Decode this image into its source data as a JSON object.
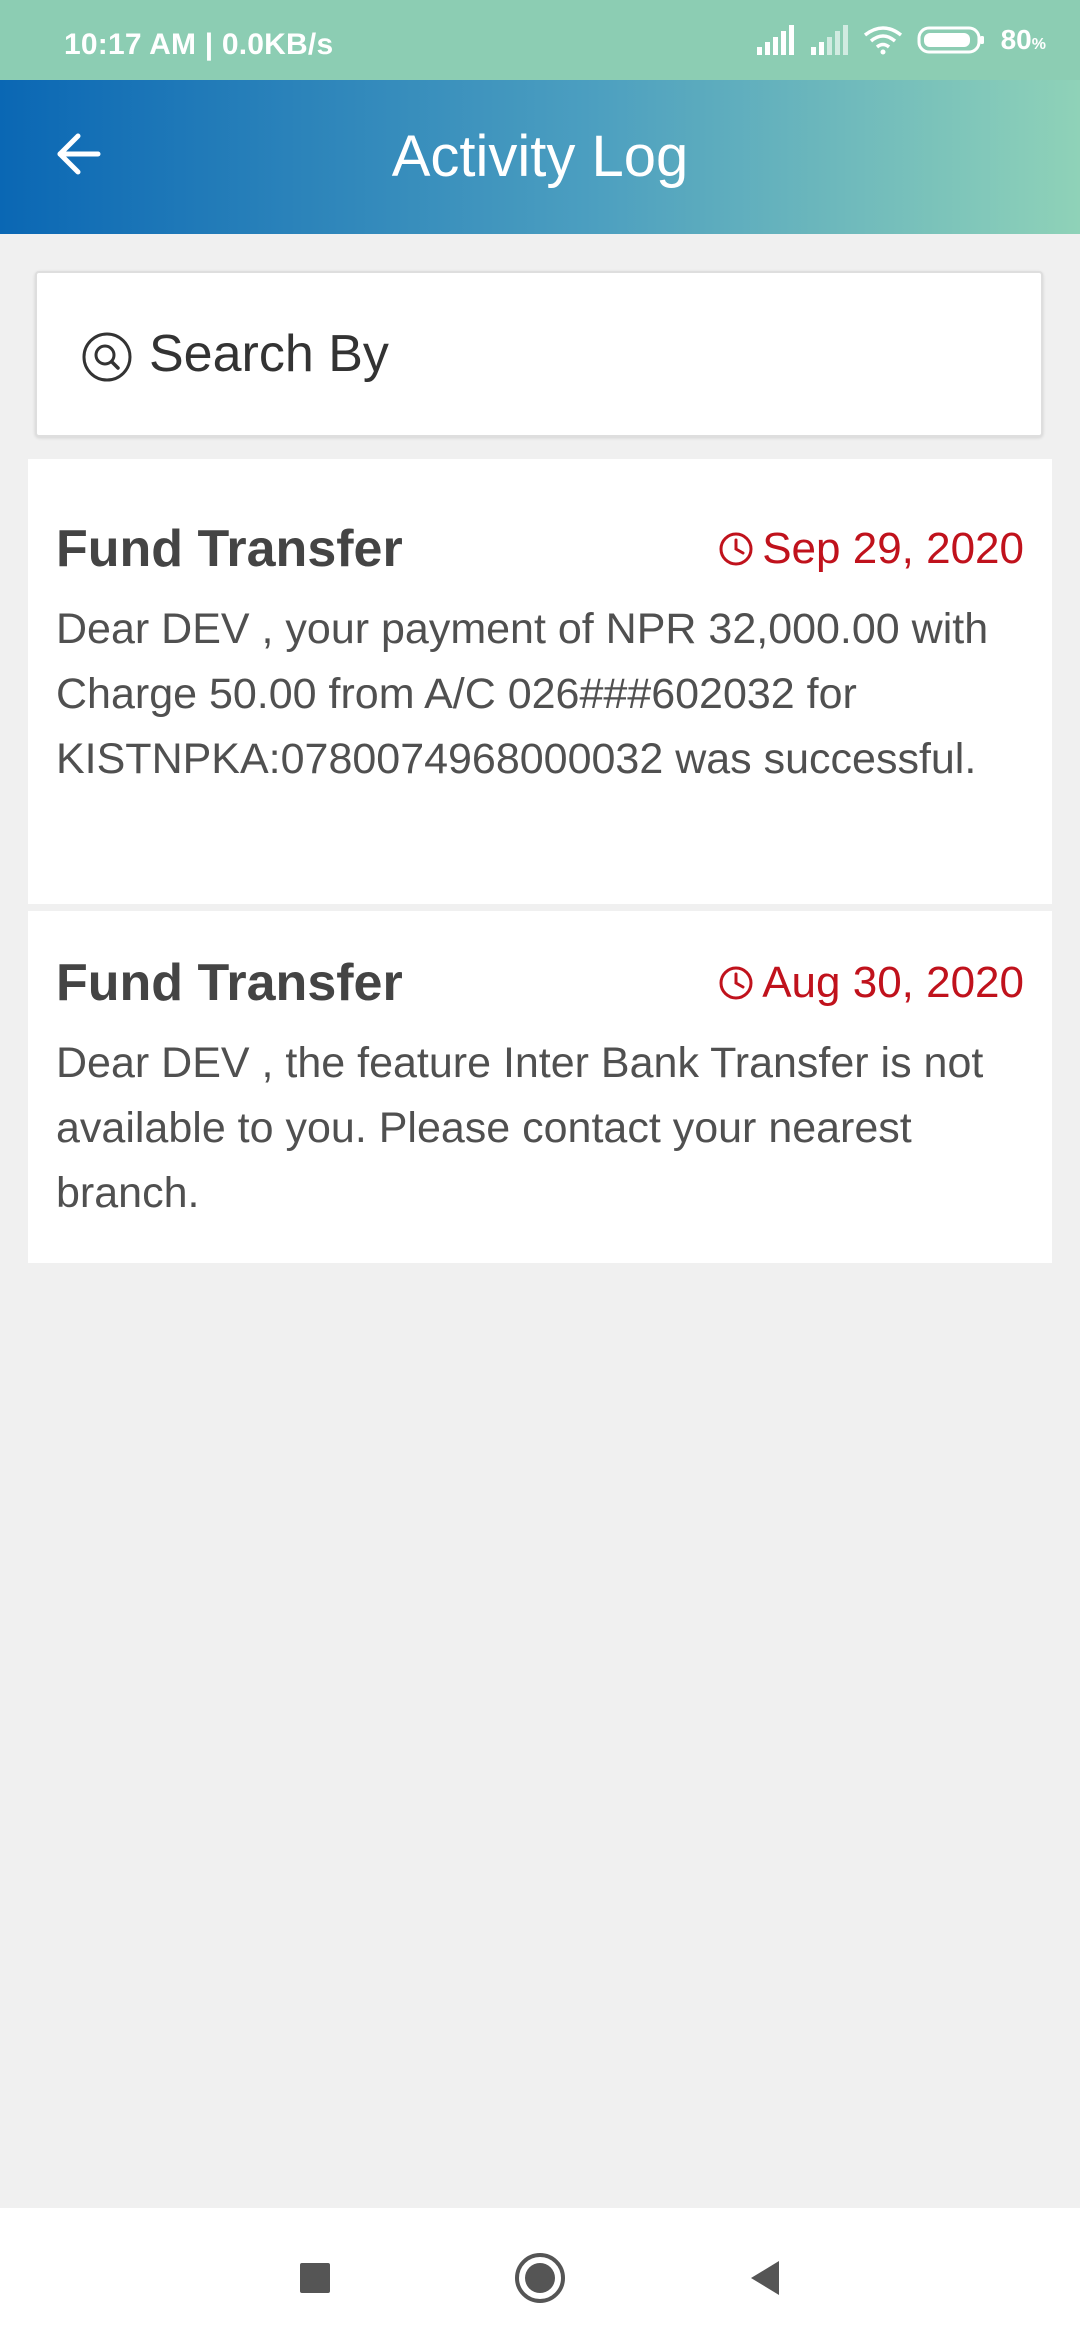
{
  "status_bar": {
    "time": "10:17 AM | 0.0KB/s",
    "battery": "80",
    "battery_unit": "%",
    "icons": [
      "signal-icon",
      "signal-icon",
      "wifi-icon",
      "battery-icon"
    ]
  },
  "app_bar": {
    "title": "Activity Log",
    "back_icon": "arrow-left-icon"
  },
  "search": {
    "label": "Search By",
    "icon": "search-icon"
  },
  "activities": [
    {
      "title": "Fund Transfer",
      "date": "Sep 29, 2020",
      "message": "Dear DEV , your payment of NPR 32,000.00 with Charge 50.00 from A/C 026###602032 for KISTNPKA:0780074968000032 was successful."
    },
    {
      "title": "Fund Transfer",
      "date": "Aug 30, 2020",
      "message": "Dear DEV , the feature Inter Bank Transfer is not available to you. Please contact your nearest branch."
    }
  ],
  "nav_bar": {
    "buttons": [
      "recents-square-icon",
      "home-circle-icon",
      "back-triangle-icon"
    ]
  },
  "colors": {
    "status_bar": "#8ccdb3",
    "app_bar_start": "#0a67b4",
    "app_bar_end": "#8fd2b8",
    "date_red": "#c0121c",
    "background": "#f0f0f0"
  }
}
